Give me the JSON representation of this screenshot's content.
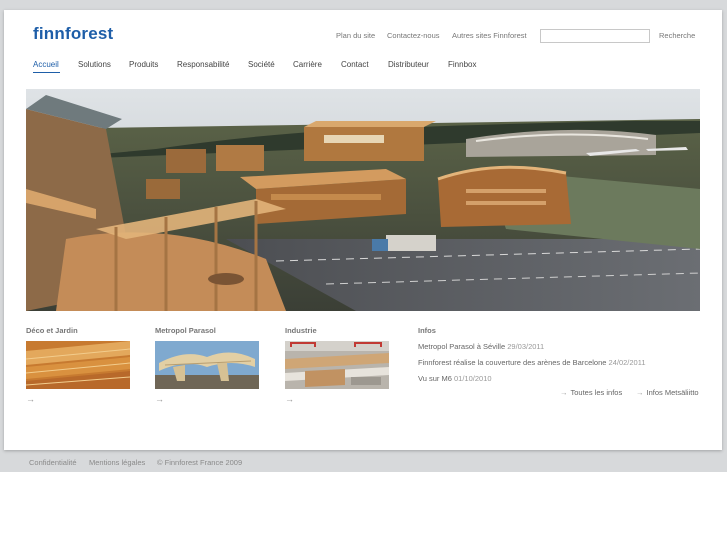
{
  "brand": {
    "logo_text": "finnforest",
    "accent": "#1e5ea8"
  },
  "toplinks": [
    "Plan du site",
    "Contactez-nous",
    "Autres sites Finnforest"
  ],
  "search": {
    "placeholder": "",
    "button_label": "Recherche"
  },
  "nav": {
    "active": "Accueil",
    "items": [
      "Accueil",
      "Solutions",
      "Produits",
      "Responsabilité",
      "Société",
      "Carrière",
      "Contact",
      "Distributeur",
      "Finnbox"
    ]
  },
  "features": [
    {
      "title": "Déco et Jardin",
      "arrow": "→"
    },
    {
      "title": "Metropol Parasol",
      "arrow": "→"
    },
    {
      "title": "Industrie",
      "arrow": "→"
    }
  ],
  "infos": {
    "title": "Infos",
    "items": [
      {
        "text": "Metropol Parasol à Séville",
        "date": "29/03/2011"
      },
      {
        "text": "Finnforest réalise la couverture des arènes de Barcelone",
        "date": "24/02/2011"
      },
      {
        "text": "Vu sur M6",
        "date": "01/10/2010"
      }
    ],
    "links": [
      {
        "arrow": "→",
        "label": "Toutes les infos"
      },
      {
        "arrow": "→",
        "label": "Infos Metsäliitto"
      }
    ]
  },
  "footer": [
    "Confidentialité",
    "Mentions légales",
    "© Finnforest France 2009"
  ]
}
